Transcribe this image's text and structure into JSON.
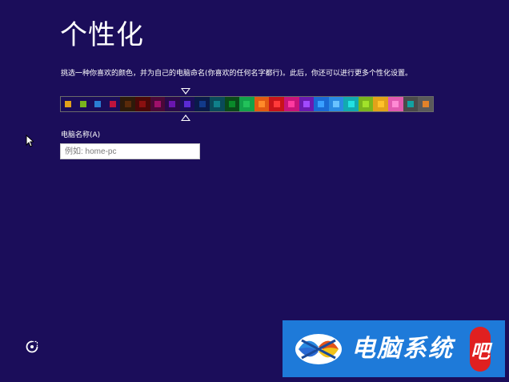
{
  "page": {
    "title": "个性化",
    "description": "挑选一种你喜欢的颜色，并为自己的电脑命名(你喜欢的任何名字都行)。此后，你还可以进行更多个性化设置。"
  },
  "palette": {
    "selected_index": 8,
    "swatches": [
      {
        "bg": "#1b0d5a",
        "chip": "#e2a21a"
      },
      {
        "bg": "#1b0d5a",
        "chip": "#7ab51d"
      },
      {
        "bg": "#1b0d5a",
        "chip": "#2a7fd4"
      },
      {
        "bg": "#1b0d5a",
        "chip": "#c0143c"
      },
      {
        "bg": "#2d1a0a",
        "chip": "#5a2a0a"
      },
      {
        "bg": "#4a0808",
        "chip": "#8a1010"
      },
      {
        "bg": "#4a0838",
        "chip": "#a0106a"
      },
      {
        "bg": "#2a0a4a",
        "chip": "#6a16b0"
      },
      {
        "bg": "#1b0d5a",
        "chip": "#5a2ad4"
      },
      {
        "bg": "#0a1a4a",
        "chip": "#123a8a"
      },
      {
        "bg": "#0a4a5a",
        "chip": "#10808a"
      },
      {
        "bg": "#0a4a1a",
        "chip": "#0a8a2a"
      },
      {
        "bg": "#12a24a",
        "chip": "#22c25a"
      },
      {
        "bg": "#e25a12",
        "chip": "#ff8a2a"
      },
      {
        "bg": "#c8141a",
        "chip": "#ff3a3a"
      },
      {
        "bg": "#c8147a",
        "chip": "#ff3aa0"
      },
      {
        "bg": "#6a1ab0",
        "chip": "#a04aff"
      },
      {
        "bg": "#1a6ad4",
        "chip": "#3aa0ff"
      },
      {
        "bg": "#2a8ae2",
        "chip": "#6ac2ff"
      },
      {
        "bg": "#12aab0",
        "chip": "#22e2e2"
      },
      {
        "bg": "#7ab51d",
        "chip": "#a2e22a"
      },
      {
        "bg": "#e2a21a",
        "chip": "#ffc22a"
      },
      {
        "bg": "#e25ab0",
        "chip": "#ff8ad4"
      },
      {
        "bg": "#4a4a4a",
        "chip": "#12a2a2"
      },
      {
        "bg": "#5a5a5a",
        "chip": "#e2822a"
      }
    ]
  },
  "pc_name": {
    "label": "电脑名称(A)",
    "value": "",
    "placeholder": "例如: home-pc"
  },
  "icons": {
    "cursor": "mouse-pointer-icon",
    "ease_of_access": "ease-of-access-icon"
  },
  "watermark": {
    "text": "电脑系统",
    "badge": "吧"
  }
}
